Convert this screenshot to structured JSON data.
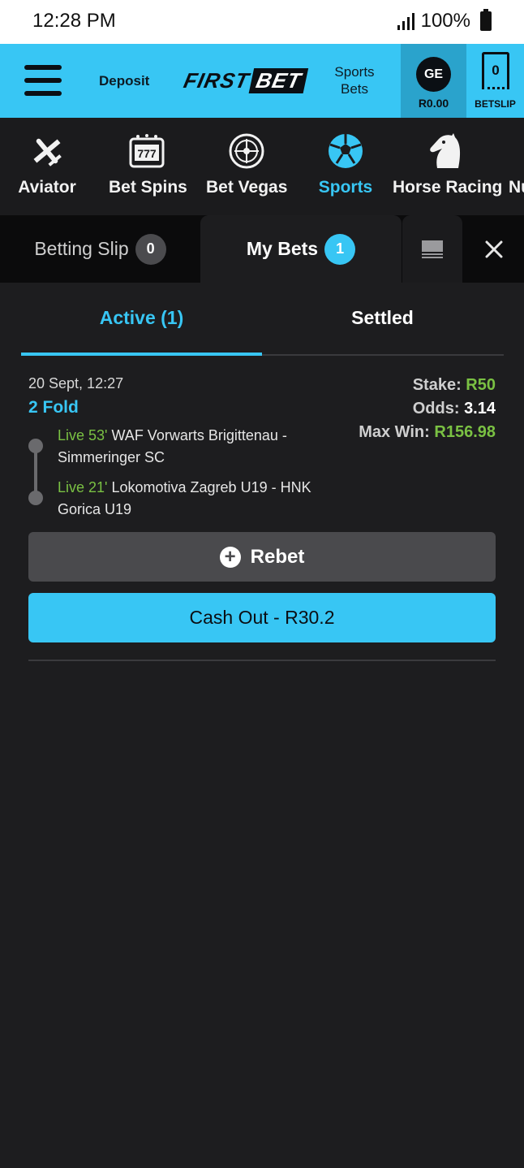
{
  "status_bar": {
    "time": "12:28 PM",
    "battery_percent": "100%"
  },
  "header": {
    "deposit_label": "Deposit",
    "logo_first": "FIRST",
    "logo_bet": "BET",
    "sports_bets_line1": "Sports",
    "sports_bets_line2": "Bets",
    "account_initials": "GE",
    "balance": "R0.00",
    "betslip_count": "0",
    "betslip_label": "BETSLIP",
    "brand_color": "#38c6f4"
  },
  "categories": [
    {
      "label": "Aviator",
      "icon": "aviator-plane-icon"
    },
    {
      "label": "Bet Spins",
      "icon": "slot-machine-icon"
    },
    {
      "label": "Bet Vegas",
      "icon": "roulette-icon"
    },
    {
      "label": "Sports",
      "icon": "soccer-ball-icon",
      "active": true
    },
    {
      "label": "Horse Racing",
      "icon": "horse-head-icon"
    },
    {
      "label": "Nu",
      "icon": ""
    }
  ],
  "slip_tabs": {
    "betting_slip_label": "Betting Slip",
    "betting_slip_count": "0",
    "my_bets_label": "My Bets",
    "my_bets_count": "1"
  },
  "sub_tabs": {
    "active_label": "Active (1)",
    "settled_label": "Settled"
  },
  "bet": {
    "date": "20 Sept, 12:27",
    "type": "2 Fold",
    "stake_label": "Stake:",
    "stake_value": "R50",
    "odds_label": "Odds:",
    "odds_value": "3.14",
    "max_win_label": "Max Win:",
    "max_win_value": "R156.98",
    "legs": [
      {
        "live": "Live 53'",
        "match": " WAF Vorwarts Brigittenau - Simmeringer SC"
      },
      {
        "live": "Live 21'",
        "match": " Lokomotiva Zagreb U19 - HNK Gorica U19"
      }
    ],
    "rebet_label": "Rebet",
    "cashout_label": "Cash Out - R30.2"
  }
}
